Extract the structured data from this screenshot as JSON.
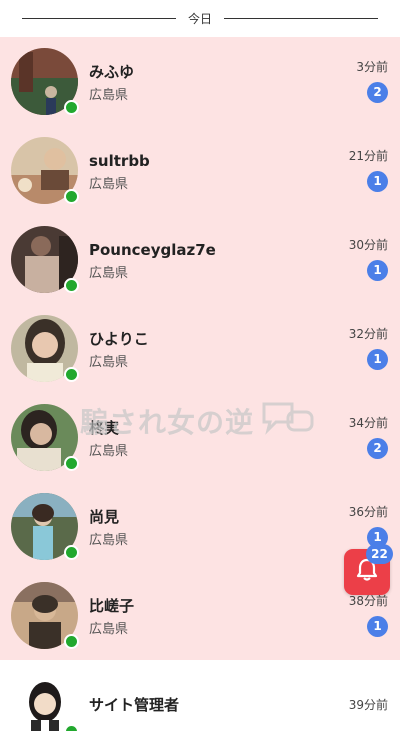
{
  "section": {
    "today_label": "今日"
  },
  "conversations": [
    {
      "name": "みふゆ",
      "prefecture": "広島県",
      "time": "3分前",
      "unread": "2",
      "online": true,
      "colors": [
        "#7a4a3a",
        "#3c5a3a",
        "#c9b6a0"
      ]
    },
    {
      "name": "sultrbb",
      "prefecture": "広島県",
      "time": "21分前",
      "unread": "1",
      "online": true,
      "colors": [
        "#b88a6a",
        "#d8c4a8",
        "#6a4a38"
      ]
    },
    {
      "name": "Pounceyglaz7e",
      "prefecture": "広島県",
      "time": "30分前",
      "unread": "1",
      "online": true,
      "colors": [
        "#4a3a34",
        "#8a6a5a",
        "#c8b0a0"
      ]
    },
    {
      "name": "ひよりこ",
      "prefecture": "広島県",
      "time": "32分前",
      "unread": "1",
      "online": true,
      "colors": [
        "#3a3028",
        "#e8c8b0",
        "#c0b8a0"
      ]
    },
    {
      "name": "柊実",
      "prefecture": "広島県",
      "time": "34分前",
      "unread": "2",
      "online": true,
      "colors": [
        "#2c2420",
        "#d8b8a0",
        "#6a8a5a"
      ]
    },
    {
      "name": "尚見",
      "prefecture": "広島県",
      "time": "36分前",
      "unread": "1",
      "online": true,
      "colors": [
        "#5a6a4a",
        "#e0c8b0",
        "#8ab0c0"
      ]
    },
    {
      "name": "比嵯子",
      "prefecture": "広島県",
      "time": "38分前",
      "unread": "1",
      "online": true,
      "colors": [
        "#8a7060",
        "#c8a888",
        "#3a3028"
      ]
    }
  ],
  "admin": {
    "name": "サイト管理者",
    "time": "39分前",
    "online": true
  },
  "watermark": {
    "text": "騙され女の逆"
  },
  "notification": {
    "count": "22",
    "icon": "bell-icon",
    "color": "#ec3f48"
  },
  "colors": {
    "unread_bg": "#fde3e3",
    "badge": "#4b7fe8",
    "online": "#22a82e"
  }
}
